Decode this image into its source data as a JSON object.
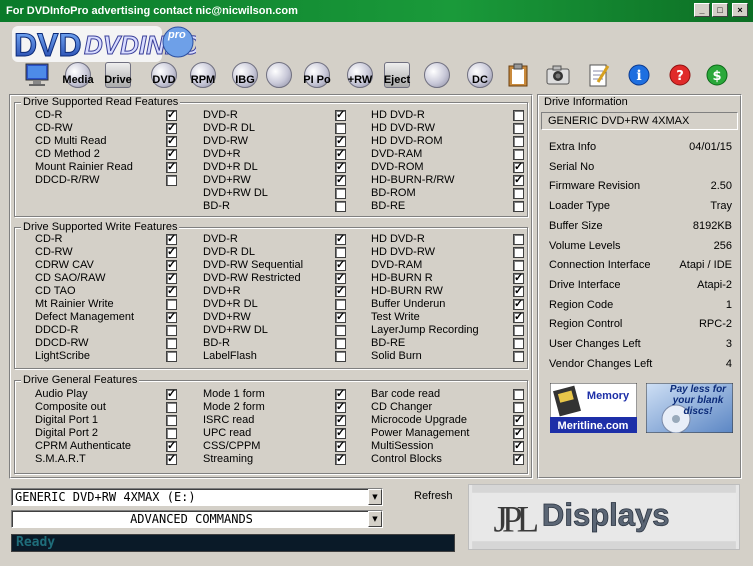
{
  "window": {
    "title": "For DVDInfoPro advertising contact nic@nicwilson.com",
    "minimize_glyph": "_",
    "maximize_glyph": "□",
    "close_glyph": "×"
  },
  "toolbar": {
    "logo_text": "DVDINFO",
    "logo_sub": "pro",
    "buttons": [
      {
        "label": "",
        "icon": "monitor-icon"
      },
      {
        "label": "Media",
        "icon": "disc-icon"
      },
      {
        "label": "Drive",
        "icon": "drive-icon"
      },
      {
        "label": "DVD",
        "icon": "disc-icon"
      },
      {
        "label": "RPM",
        "icon": "disc-icon"
      },
      {
        "label": "IBG",
        "icon": "disc-icon"
      },
      {
        "label": "",
        "icon": "magnifier-icon"
      },
      {
        "label": "PI Po",
        "icon": "disc-icon"
      },
      {
        "label": "+RW",
        "icon": "disc-icon"
      },
      {
        "label": "Eject",
        "icon": "drive-icon"
      },
      {
        "label": "",
        "icon": "wrench-disc-icon"
      },
      {
        "label": "DC",
        "icon": "disc-icon"
      },
      {
        "label": "",
        "icon": "clipboard-icon"
      },
      {
        "label": "",
        "icon": "camera-icon"
      },
      {
        "label": "",
        "icon": "notepad-icon"
      },
      {
        "label": "",
        "icon": "info-icon"
      },
      {
        "label": "",
        "icon": "help-icon"
      },
      {
        "label": "",
        "icon": "dollar-icon"
      }
    ],
    "info_glyph": "i",
    "help_glyph": "?",
    "dollar_glyph": "$"
  },
  "read_features": {
    "title": "Drive Supported Read Features",
    "columns": [
      [
        {
          "label": "CD-R",
          "checked": true
        },
        {
          "label": "CD-RW",
          "checked": true
        },
        {
          "label": "CD Multi Read",
          "checked": true
        },
        {
          "label": "CD Method 2",
          "checked": true
        },
        {
          "label": "Mount Rainier Read",
          "checked": true
        },
        {
          "label": "DDCD-R/RW",
          "checked": false
        }
      ],
      [
        {
          "label": "DVD-R",
          "checked": true
        },
        {
          "label": "DVD-R DL",
          "checked": false
        },
        {
          "label": "DVD-RW",
          "checked": true
        },
        {
          "label": "DVD+R",
          "checked": true
        },
        {
          "label": "DVD+R DL",
          "checked": true
        },
        {
          "label": "DVD+RW",
          "checked": true
        },
        {
          "label": "DVD+RW DL",
          "checked": false
        },
        {
          "label": "BD-R",
          "checked": false
        }
      ],
      [
        {
          "label": "HD DVD-R",
          "checked": false
        },
        {
          "label": "HD DVD-RW",
          "checked": false
        },
        {
          "label": "HD DVD-ROM",
          "checked": false
        },
        {
          "label": "DVD-RAM",
          "checked": false
        },
        {
          "label": "DVD-ROM",
          "checked": true
        },
        {
          "label": "HD-BURN-R/RW",
          "checked": true
        },
        {
          "label": "BD-ROM",
          "checked": false
        },
        {
          "label": "BD-RE",
          "checked": false
        }
      ]
    ]
  },
  "write_features": {
    "title": "Drive Supported Write Features",
    "columns": [
      [
        {
          "label": "CD-R",
          "checked": true
        },
        {
          "label": "CD-RW",
          "checked": true
        },
        {
          "label": "CDRW CAV",
          "checked": true
        },
        {
          "label": "CD SAO/RAW",
          "checked": true
        },
        {
          "label": "CD TAO",
          "checked": true
        },
        {
          "label": "Mt Rainier Write",
          "checked": false
        },
        {
          "label": "Defect Management",
          "checked": true
        },
        {
          "label": "DDCD-R",
          "checked": false
        },
        {
          "label": "DDCD-RW",
          "checked": false
        },
        {
          "label": "LightScribe",
          "checked": false
        }
      ],
      [
        {
          "label": "DVD-R",
          "checked": true
        },
        {
          "label": "DVD-R DL",
          "checked": false
        },
        {
          "label": "DVD-RW Sequential",
          "checked": true
        },
        {
          "label": "DVD-RW Restricted",
          "checked": true
        },
        {
          "label": "DVD+R",
          "checked": true
        },
        {
          "label": "DVD+R DL",
          "checked": false
        },
        {
          "label": "DVD+RW",
          "checked": true
        },
        {
          "label": "DVD+RW DL",
          "checked": false
        },
        {
          "label": "BD-R",
          "checked": false
        },
        {
          "label": "LabelFlash",
          "checked": false
        }
      ],
      [
        {
          "label": "HD DVD-R",
          "checked": false
        },
        {
          "label": "HD DVD-RW",
          "checked": false
        },
        {
          "label": "DVD-RAM",
          "checked": false
        },
        {
          "label": "HD-BURN R",
          "checked": true
        },
        {
          "label": "HD-BURN RW",
          "checked": true
        },
        {
          "label": "Buffer Underun",
          "checked": true
        },
        {
          "label": "Test Write",
          "checked": true
        },
        {
          "label": "LayerJump Recording",
          "checked": false
        },
        {
          "label": "BD-RE",
          "checked": false
        },
        {
          "label": "Solid Burn",
          "checked": false
        }
      ]
    ]
  },
  "general_features": {
    "title": "Drive General Features",
    "columns": [
      [
        {
          "label": "Audio Play",
          "checked": true
        },
        {
          "label": "Composite out",
          "checked": false
        },
        {
          "label": "Digital Port 1",
          "checked": false
        },
        {
          "label": "Digital Port 2",
          "checked": false
        },
        {
          "label": "CPRM Authenticate",
          "checked": true
        },
        {
          "label": "S.M.A.R.T",
          "checked": true
        }
      ],
      [
        {
          "label": "Mode 1 form",
          "checked": true
        },
        {
          "label": "Mode 2 form",
          "checked": true
        },
        {
          "label": "ISRC read",
          "checked": true
        },
        {
          "label": "UPC read",
          "checked": true
        },
        {
          "label": "CSS/CPPM",
          "checked": true
        },
        {
          "label": "Streaming",
          "checked": true
        }
      ],
      [
        {
          "label": "Bar code read",
          "checked": false
        },
        {
          "label": "CD Changer",
          "checked": false
        },
        {
          "label": "Microcode Upgrade",
          "checked": true
        },
        {
          "label": "Power Management",
          "checked": true
        },
        {
          "label": "MultiSession",
          "checked": true
        },
        {
          "label": "Control Blocks",
          "checked": true
        }
      ]
    ]
  },
  "drive_info": {
    "title": "Drive Information",
    "model": "GENERIC DVD+RW 4XMAX",
    "rows": [
      {
        "label": "Extra Info",
        "value": "04/01/15"
      },
      {
        "label": "Serial No",
        "value": ""
      },
      {
        "label": "Firmware Revision",
        "value": "2.50"
      },
      {
        "label": "Loader Type",
        "value": "Tray"
      },
      {
        "label": "Buffer Size",
        "value": "8192KB"
      },
      {
        "label": "Volume Levels",
        "value": "256"
      },
      {
        "label": "Connection Interface",
        "value": "Atapi / IDE"
      },
      {
        "label": "Drive Interface",
        "value": "Atapi-2"
      },
      {
        "label": "Region Code",
        "value": "1"
      },
      {
        "label": "Region Control",
        "value": "RPC-2"
      },
      {
        "label": "User Changes Left",
        "value": "3"
      },
      {
        "label": "Vendor Changes Left",
        "value": "4"
      }
    ]
  },
  "ads": {
    "meritline_top": "Memory",
    "meritline_bottom": "Meritline.com",
    "blank_discs": "Pay less for your blank discs!",
    "jpl_text": "Displays",
    "jpl_letters": "JPL"
  },
  "bottom": {
    "drive_select": "GENERIC DVD+RW 4XMAX (E:)",
    "advanced": "ADVANCED COMMANDS",
    "refresh_label": "Refresh",
    "status_text": "Ready",
    "arrow_glyph": "▼"
  }
}
